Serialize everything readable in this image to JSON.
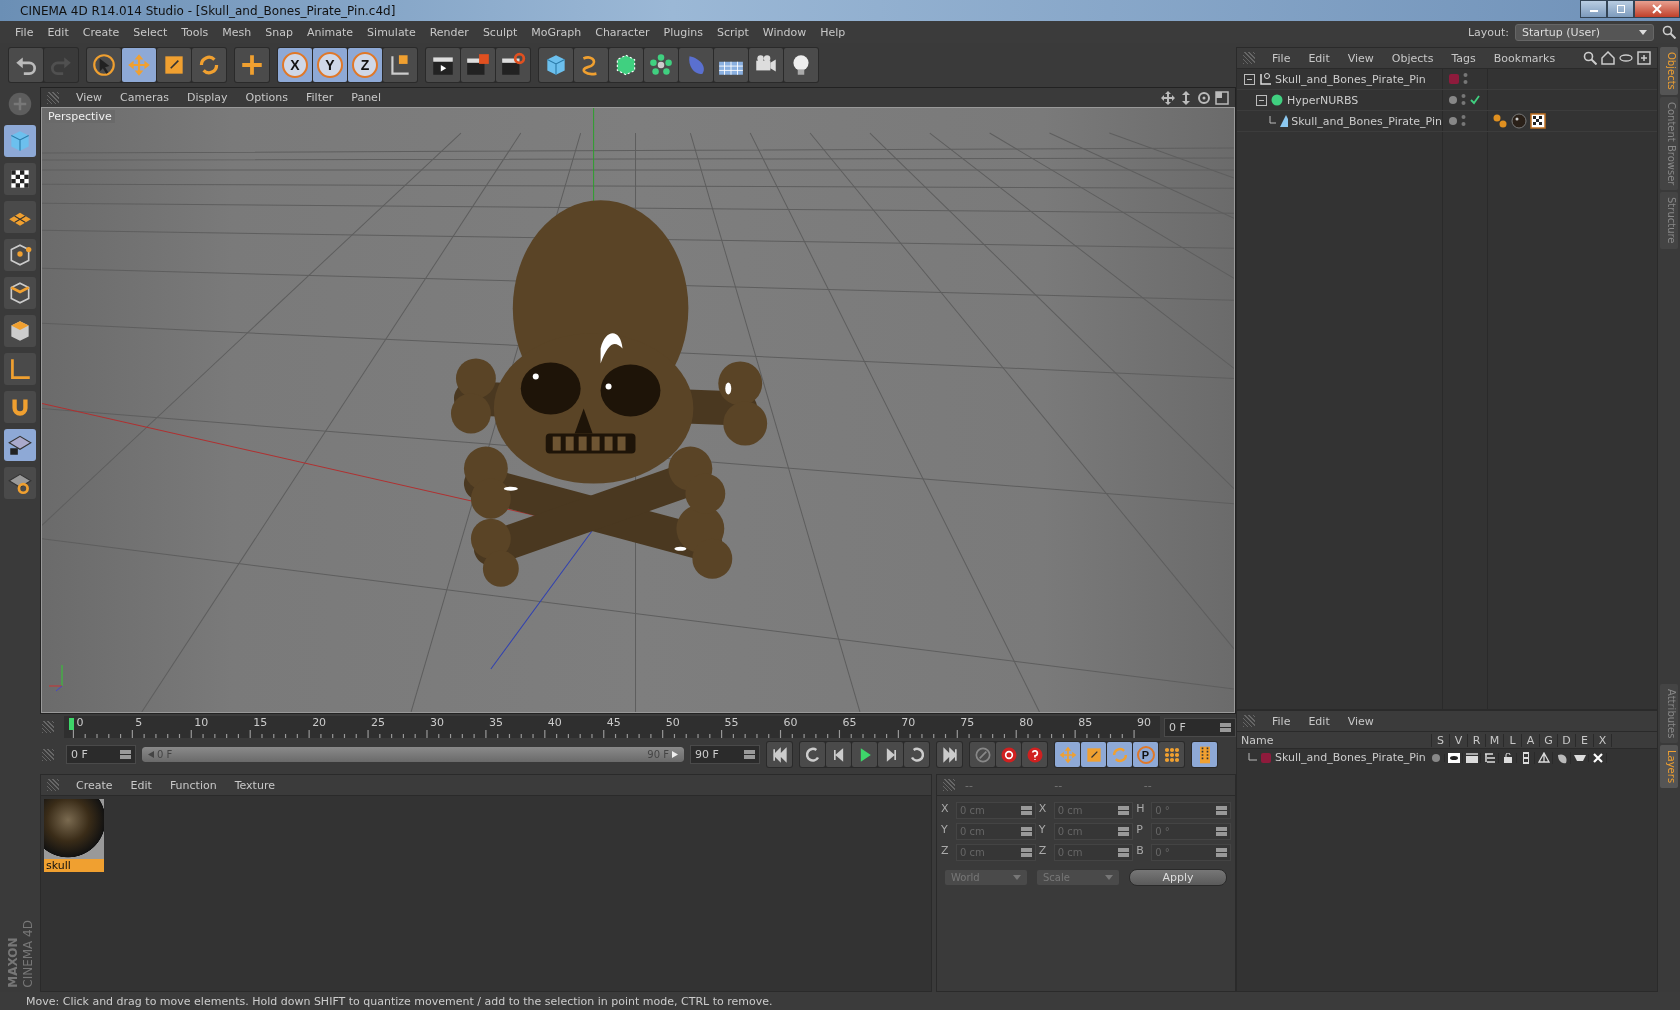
{
  "window": {
    "title": "CINEMA 4D R14.014 Studio - [Skull_and_Bones_Pirate_Pin.c4d]"
  },
  "menu": [
    "File",
    "Edit",
    "Create",
    "Select",
    "Tools",
    "Mesh",
    "Snap",
    "Animate",
    "Simulate",
    "Render",
    "Sculpt",
    "MoGraph",
    "Character",
    "Plugins",
    "Script",
    "Window",
    "Help"
  ],
  "layout": {
    "label": "Layout:",
    "value": "Startup (User)"
  },
  "toolbar": [
    [
      {
        "kind": "undo",
        "selected": false,
        "disabled": false
      },
      {
        "kind": "redo",
        "selected": false,
        "disabled": true
      }
    ],
    [
      {
        "kind": "select",
        "selected": false,
        "disabled": false
      },
      {
        "kind": "move",
        "selected": true,
        "disabled": false
      },
      {
        "kind": "scale",
        "selected": false,
        "disabled": false
      },
      {
        "kind": "rotate",
        "selected": false,
        "disabled": false
      }
    ],
    [
      {
        "kind": "last",
        "selected": false,
        "disabled": false
      }
    ],
    [
      {
        "kind": "axis",
        "label": "X",
        "selected": true,
        "disabled": false
      },
      {
        "kind": "axis",
        "label": "Y",
        "selected": true,
        "disabled": false
      },
      {
        "kind": "axis",
        "label": "Z",
        "selected": true,
        "disabled": false
      },
      {
        "kind": "coords",
        "selected": false,
        "disabled": false
      }
    ],
    [
      {
        "kind": "render-view",
        "selected": false,
        "disabled": false
      },
      {
        "kind": "render-pic",
        "selected": false,
        "disabled": false
      },
      {
        "kind": "render-settings",
        "selected": false,
        "disabled": false
      }
    ],
    [
      {
        "kind": "cube",
        "selected": false,
        "disabled": false
      },
      {
        "kind": "spline",
        "selected": false,
        "disabled": false
      },
      {
        "kind": "nurbs",
        "selected": false,
        "disabled": false
      },
      {
        "kind": "array",
        "selected": false,
        "disabled": false
      },
      {
        "kind": "deformer",
        "selected": false,
        "disabled": false
      },
      {
        "kind": "floor",
        "selected": false,
        "disabled": false
      },
      {
        "kind": "camera",
        "selected": false,
        "disabled": false
      },
      {
        "kind": "light",
        "selected": false,
        "disabled": false
      }
    ]
  ],
  "left_tools": [
    {
      "kind": "cube",
      "selected": true
    },
    {
      "kind": "checker",
      "selected": false
    },
    {
      "kind": "workplane",
      "selected": false
    },
    {
      "kind": "points",
      "selected": false
    },
    {
      "kind": "edges",
      "selected": false
    },
    {
      "kind": "polygons",
      "selected": false
    },
    {
      "kind": "axis-l",
      "selected": false
    },
    {
      "kind": "magnet",
      "selected": false
    },
    {
      "kind": "grid-lock",
      "selected": true
    },
    {
      "kind": "grid-rotate",
      "selected": false
    }
  ],
  "viewport": {
    "menu": [
      "View",
      "Cameras",
      "Display",
      "Options",
      "Filter",
      "Panel"
    ],
    "camera_label": "Perspective"
  },
  "timeline": {
    "ticks": [
      "0",
      "5",
      "10",
      "15",
      "20",
      "25",
      "30",
      "35",
      "40",
      "45",
      "50",
      "55",
      "60",
      "65",
      "70",
      "75",
      "80",
      "85",
      "90"
    ],
    "level": 0,
    "frame_field": "0 F",
    "start_field": "0 F",
    "range": {
      "start": "0 F",
      "end": "90 F",
      "level": 1
    },
    "end_field": "90 F",
    "transport": [
      {
        "kind": "first",
        "selected": false
      },
      {
        "kind": "prev-key",
        "selected": false
      },
      {
        "kind": "prev",
        "selected": false
      },
      {
        "kind": "play",
        "selected": false
      },
      {
        "kind": "next",
        "selected": false
      },
      {
        "kind": "next-key",
        "selected": false
      },
      {
        "kind": "end",
        "selected": false
      }
    ],
    "record": [
      {
        "kind": "keys",
        "selected": false
      },
      {
        "kind": "record",
        "selected": false
      },
      {
        "kind": "auto",
        "selected": false
      }
    ],
    "keys": [
      {
        "kind": "move",
        "selected": true
      },
      {
        "kind": "scale",
        "selected": true
      },
      {
        "kind": "rotate",
        "selected": true
      },
      {
        "kind": "param",
        "label": "P",
        "selected": true
      },
      {
        "kind": "points",
        "selected": false
      }
    ],
    "film_selected": true
  },
  "materials": {
    "menu": [
      "Create",
      "Edit",
      "Function",
      "Texture"
    ],
    "items": [
      {
        "name": "skull",
        "selected": true
      }
    ]
  },
  "coordinates": {
    "headers": [
      "--",
      "--",
      "--"
    ],
    "rows": [
      {
        "axis": "X",
        "position": "0 cm",
        "size_axis": "X",
        "size": "0 cm",
        "rot_axis": "H",
        "rotation": "0 °"
      },
      {
        "axis": "Y",
        "position": "0 cm",
        "size_axis": "Y",
        "size": "0 cm",
        "rot_axis": "P",
        "rotation": "0 °"
      },
      {
        "axis": "Z",
        "position": "0 cm",
        "size_axis": "Z",
        "size": "0 cm",
        "rot_axis": "B",
        "rotation": "0 °"
      }
    ],
    "system": "World",
    "mode": "Scale",
    "apply": "Apply"
  },
  "objects": {
    "menu": [
      "File",
      "Edit",
      "View",
      "Objects",
      "Tags",
      "Bookmarks"
    ],
    "tree": [
      {
        "name": "Skull_and_Bones_Pirate_Pin",
        "kind": "null",
        "expanded": true,
        "color": "#8e1b3c",
        "enabled": false,
        "children": [
          {
            "name": "HyperNURBS",
            "kind": "nurbs",
            "expanded": true,
            "enabled": true,
            "children": [
              {
                "name": "Skull_and_Bones_Pirate_Pin",
                "kind": "mesh",
                "enabled": false,
                "tags": [
                  {
                    "kind": "phong"
                  },
                  {
                    "kind": "material"
                  },
                  {
                    "kind": "texture"
                  }
                ]
              }
            ]
          }
        ]
      }
    ]
  },
  "layers": {
    "menu": [
      "File",
      "Edit",
      "View"
    ],
    "name_header": "Name",
    "columns": [
      "S",
      "V",
      "R",
      "M",
      "L",
      "A",
      "G",
      "D",
      "E",
      "X"
    ],
    "rows": [
      {
        "name": "Skull_and_Bones_Pirate_Pin",
        "color": "#8e1b3c"
      }
    ]
  },
  "side_tabs": [
    {
      "label": "Objects",
      "selected": true
    },
    {
      "label": "Content Browser",
      "selected": false
    },
    {
      "label": "Structure",
      "selected": false
    }
  ],
  "side_tabs_lower": [
    {
      "label": "Attributes",
      "selected": false
    },
    {
      "label": "Layers",
      "selected": true
    }
  ],
  "brand": [
    "MAXON",
    "CINEMA 4D"
  ],
  "status": "Move: Click and drag to move elements. Hold down SHIFT to quantize movement / add to the selection in point mode, CTRL to remove."
}
